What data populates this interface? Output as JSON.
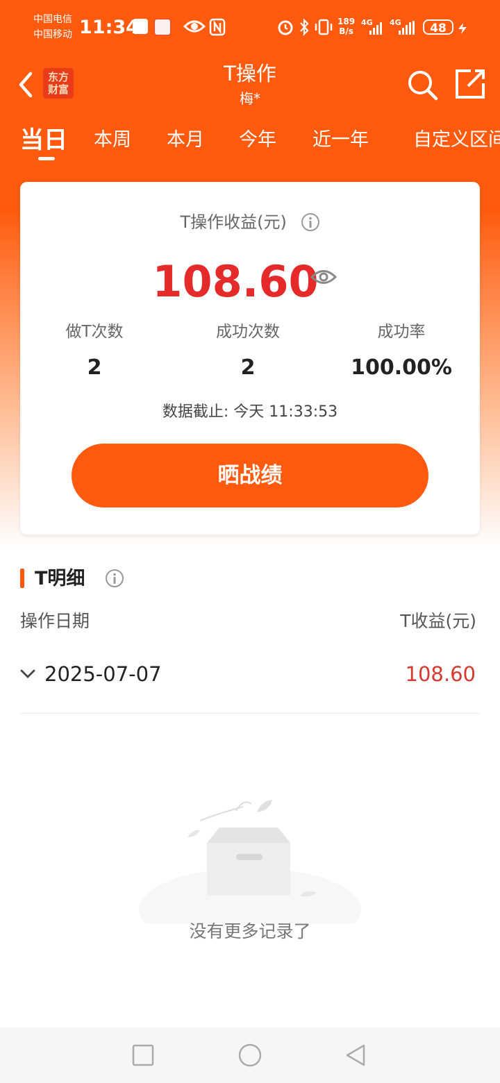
{
  "status_bar": {
    "carrier1": "中国电信",
    "carrier2": "中国移动",
    "time": "11:34",
    "net_speed_value": "189",
    "net_speed_unit": "B/s",
    "signal1": "4G",
    "signal2": "4G",
    "battery": "48"
  },
  "header": {
    "logo_line1": "东方",
    "logo_line2": "财富",
    "title": "T操作",
    "subtitle": "梅*"
  },
  "tabs": [
    {
      "label": "当日",
      "active": true
    },
    {
      "label": "本周",
      "active": false
    },
    {
      "label": "本月",
      "active": false
    },
    {
      "label": "今年",
      "active": false
    },
    {
      "label": "近一年",
      "active": false
    },
    {
      "label": "自定义区间",
      "active": false
    }
  ],
  "summary": {
    "label": "T操作收益(元)",
    "profit": "108.60",
    "stats": [
      {
        "label": "做T次数",
        "value": "2"
      },
      {
        "label": "成功次数",
        "value": "2"
      },
      {
        "label": "成功率",
        "value": "100.00%"
      }
    ],
    "data_time": "数据截止: 今天 11:33:53",
    "share_button": "晒战绩"
  },
  "details": {
    "title": "T明细",
    "col_date": "操作日期",
    "col_profit": "T收益(元)",
    "rows": [
      {
        "date": "2025-07-07",
        "profit": "108.60"
      }
    ],
    "empty_text": "没有更多记录了"
  },
  "colors": {
    "brand": "#ff5a0d",
    "profit_red": "#e52a2a"
  }
}
